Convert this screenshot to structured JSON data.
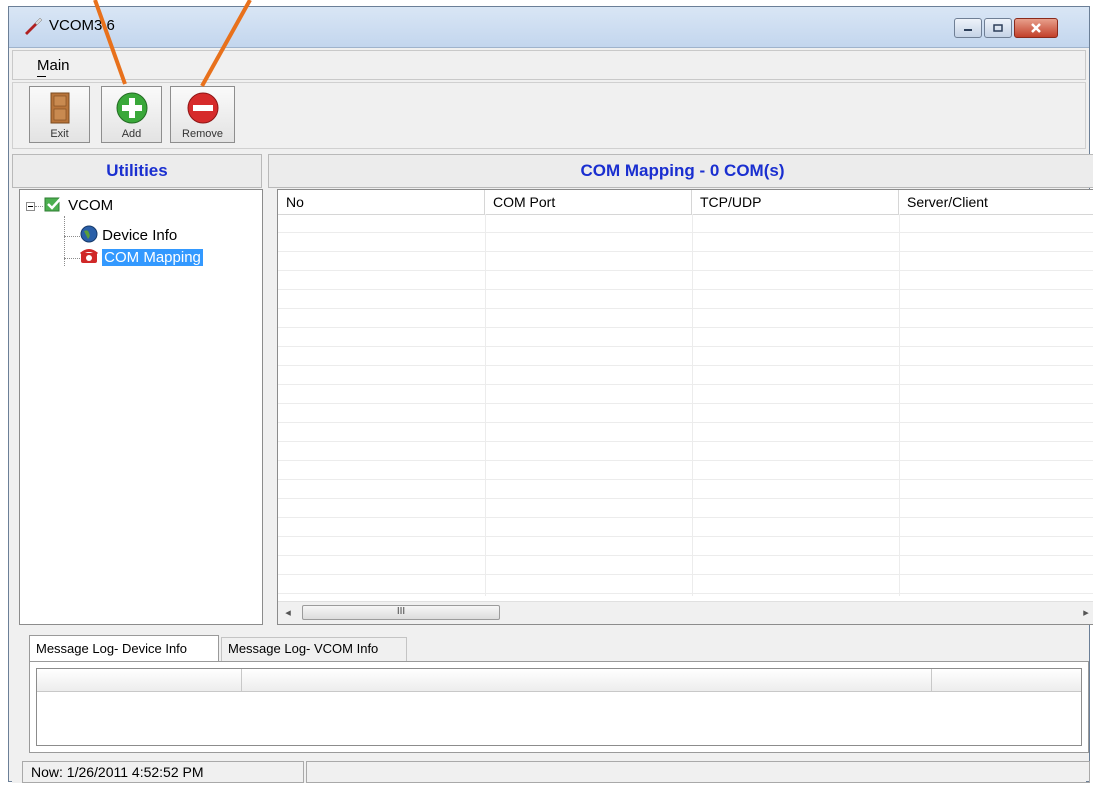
{
  "window": {
    "title": "VCOM3.6"
  },
  "menu": {
    "main_label": "Main"
  },
  "toolbar": {
    "exit_label": "Exit",
    "add_label": "Add",
    "remove_label": "Remove"
  },
  "utilities": {
    "header": "Utilities",
    "tree": {
      "root_label": "VCOM",
      "children": [
        "Device Info",
        "COM Mapping"
      ],
      "selected": "COM Mapping"
    }
  },
  "mapping": {
    "header": "COM Mapping - 0 COM(s)",
    "columns": [
      "No",
      "COM Port",
      "TCP/UDP",
      "Server/Client"
    ],
    "rows": [],
    "scroll_thumb_glyph": "III"
  },
  "log": {
    "tabs": [
      "Message Log- Device Info",
      "Message Log- VCOM Info"
    ],
    "active_tab": "Message Log- Device Info"
  },
  "status": {
    "now_text": "Now: 1/26/2011 4:52:52 PM"
  },
  "colors": {
    "accent_header": "#1a2fd0",
    "selection": "#3399ff",
    "annotation_arrow": "#e8711c"
  },
  "icons": [
    "app-icon",
    "exit-door-icon",
    "add-plus-icon",
    "remove-minus-icon",
    "vcom-check-icon",
    "globe-icon",
    "telephone-icon"
  ]
}
